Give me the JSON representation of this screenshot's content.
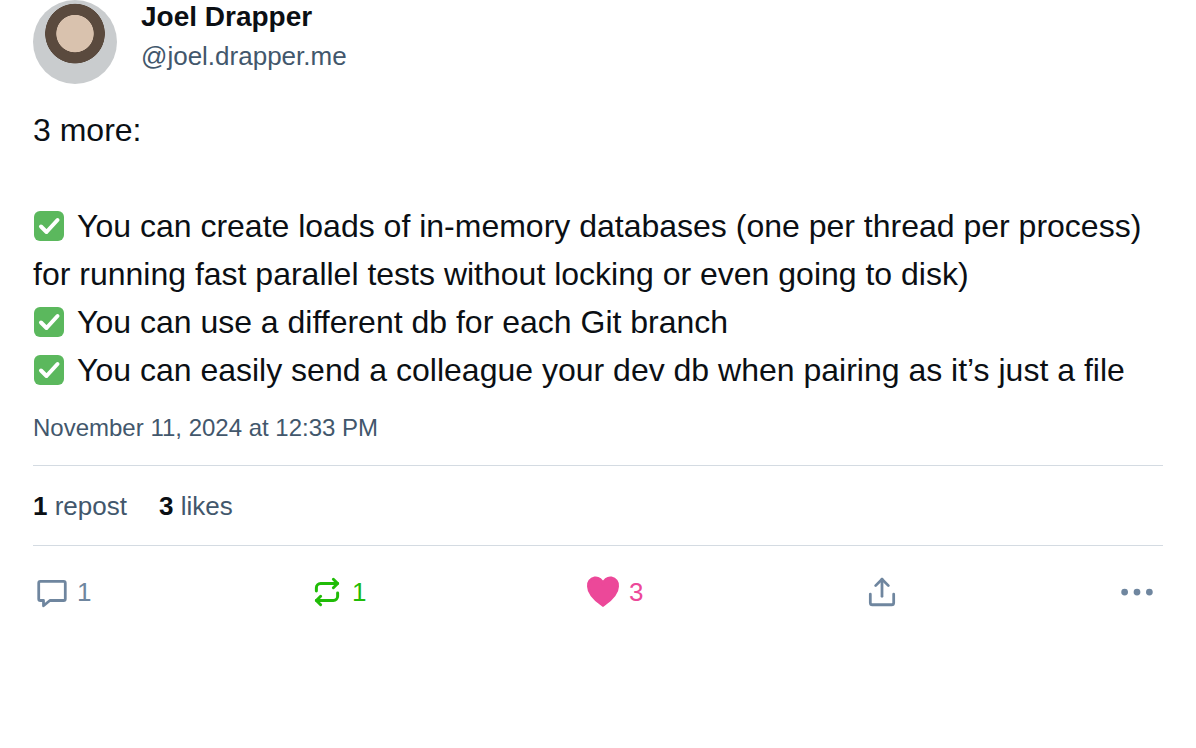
{
  "author": {
    "name": "Joel Drapper",
    "handle": "@joel.drapper.me"
  },
  "post": {
    "intro": "3 more:",
    "items": [
      {
        "text": "You can create loads of in-memory databases (one per thread per process) for running fast parallel tests without locking or even going to disk)"
      },
      {
        "text": "You can use a different db for each Git branch"
      },
      {
        "text": "You can easily send a colleague your dev db when pairing as it’s just a file"
      }
    ],
    "timestamp": "November 11, 2024 at 12:33 PM"
  },
  "stats": [
    {
      "count": "1",
      "label": "repost"
    },
    {
      "count": "3",
      "label": "likes"
    }
  ],
  "actions": {
    "reply": {
      "count": "1"
    },
    "repost": {
      "count": "1",
      "active": true
    },
    "like": {
      "count": "3",
      "active": true
    }
  }
}
